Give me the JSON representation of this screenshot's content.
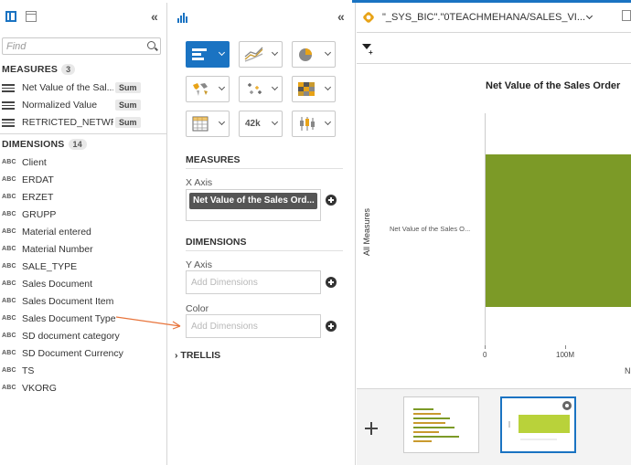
{
  "left": {
    "find_placeholder": "Find",
    "measures_title": "MEASURES",
    "measures_count": "3",
    "measures": [
      {
        "label": "Net Value of the Sal...",
        "agg": "Sum"
      },
      {
        "label": "Normalized Value",
        "agg": "Sum"
      },
      {
        "label": "RETRICTED_NETWR",
        "agg": "Sum"
      }
    ],
    "dimensions_title": "DIMENSIONS",
    "dimensions_count": "14",
    "abc": "ABC",
    "dimensions": [
      "Client",
      "ERDAT",
      "ERZET",
      "GRUPP",
      "Material entered",
      "Material Number",
      "SALE_TYPE",
      "Sales Document",
      "Sales Document Item",
      "Sales Document Type",
      "SD document category",
      "SD Document Currency",
      "TS",
      "VKORG"
    ]
  },
  "collapse_glyph": "«",
  "middle": {
    "measures_title": "MEASURES",
    "x_axis_label": "X Axis",
    "x_axis_chip": "Net Value of the Sales Ord...",
    "dimensions_title": "DIMENSIONS",
    "y_axis_label": "Y Axis",
    "y_axis_placeholder": "Add Dimensions",
    "color_label": "Color",
    "color_placeholder": "Add Dimensions",
    "trellis_label": "TRELLIS",
    "trellis_chevron": "›",
    "chart_types": [
      "bar-chart",
      "line-chart",
      "pie-chart",
      "geo-chart",
      "scatter-chart",
      "heatmap-chart",
      "table-chart",
      "numeric-point-chart",
      "boxplot-chart"
    ],
    "numeric_glyph": "42k"
  },
  "right": {
    "source_name": "\"_SYS_BIC\".\"0TEACHMEHANA/SALES_VI..."
  },
  "chart_data": {
    "type": "bar",
    "orientation": "horizontal",
    "title": "Net Value of the Sales Order",
    "ylabel": "All Measures",
    "categories": [
      "Net Value of the Sales O..."
    ],
    "x_ticks": [
      "0",
      "100M"
    ],
    "xlabel": "N",
    "bar_color": "#7c9a27"
  },
  "colors": {
    "accent": "#1a73c2",
    "bar": "#7c9a27",
    "arrow": "#e8743b"
  }
}
